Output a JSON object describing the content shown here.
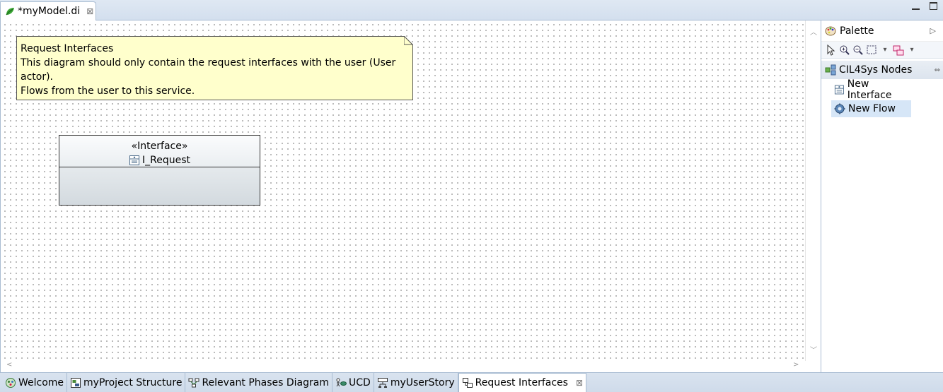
{
  "editor": {
    "tab_label": "*myModel.di",
    "tab_icon": "papyrus-leaf-icon"
  },
  "note": {
    "title": "Request Interfaces",
    "line1": "This diagram should only contain the request interfaces with the user (User actor).",
    "line2": "Flows from the user to this service."
  },
  "interface_box": {
    "stereotype": "«Interface»",
    "name": "I_Request"
  },
  "palette": {
    "title": "Palette",
    "drawer_label": "CIL4Sys Nodes",
    "entries": [
      {
        "label": "New Interface",
        "icon": "interface-icon"
      },
      {
        "label": "New Flow",
        "icon": "flow-gear-icon"
      }
    ]
  },
  "bottom_tabs": [
    {
      "label": "Welcome",
      "icon": "welcome-icon"
    },
    {
      "label": "myProject Structure",
      "icon": "structure-icon"
    },
    {
      "label": "Relevant Phases Diagram",
      "icon": "phases-icon"
    },
    {
      "label": "UCD",
      "icon": "usecase-icon"
    },
    {
      "label": "myUserStory",
      "icon": "userstory-icon"
    },
    {
      "label": "Request Interfaces",
      "icon": "request-interfaces-icon",
      "active": true
    }
  ],
  "colors": {
    "note_bg": "#ffffcc",
    "selected_entry_bg": "#d6e6f7",
    "frame_border": "#a9bcd2"
  }
}
